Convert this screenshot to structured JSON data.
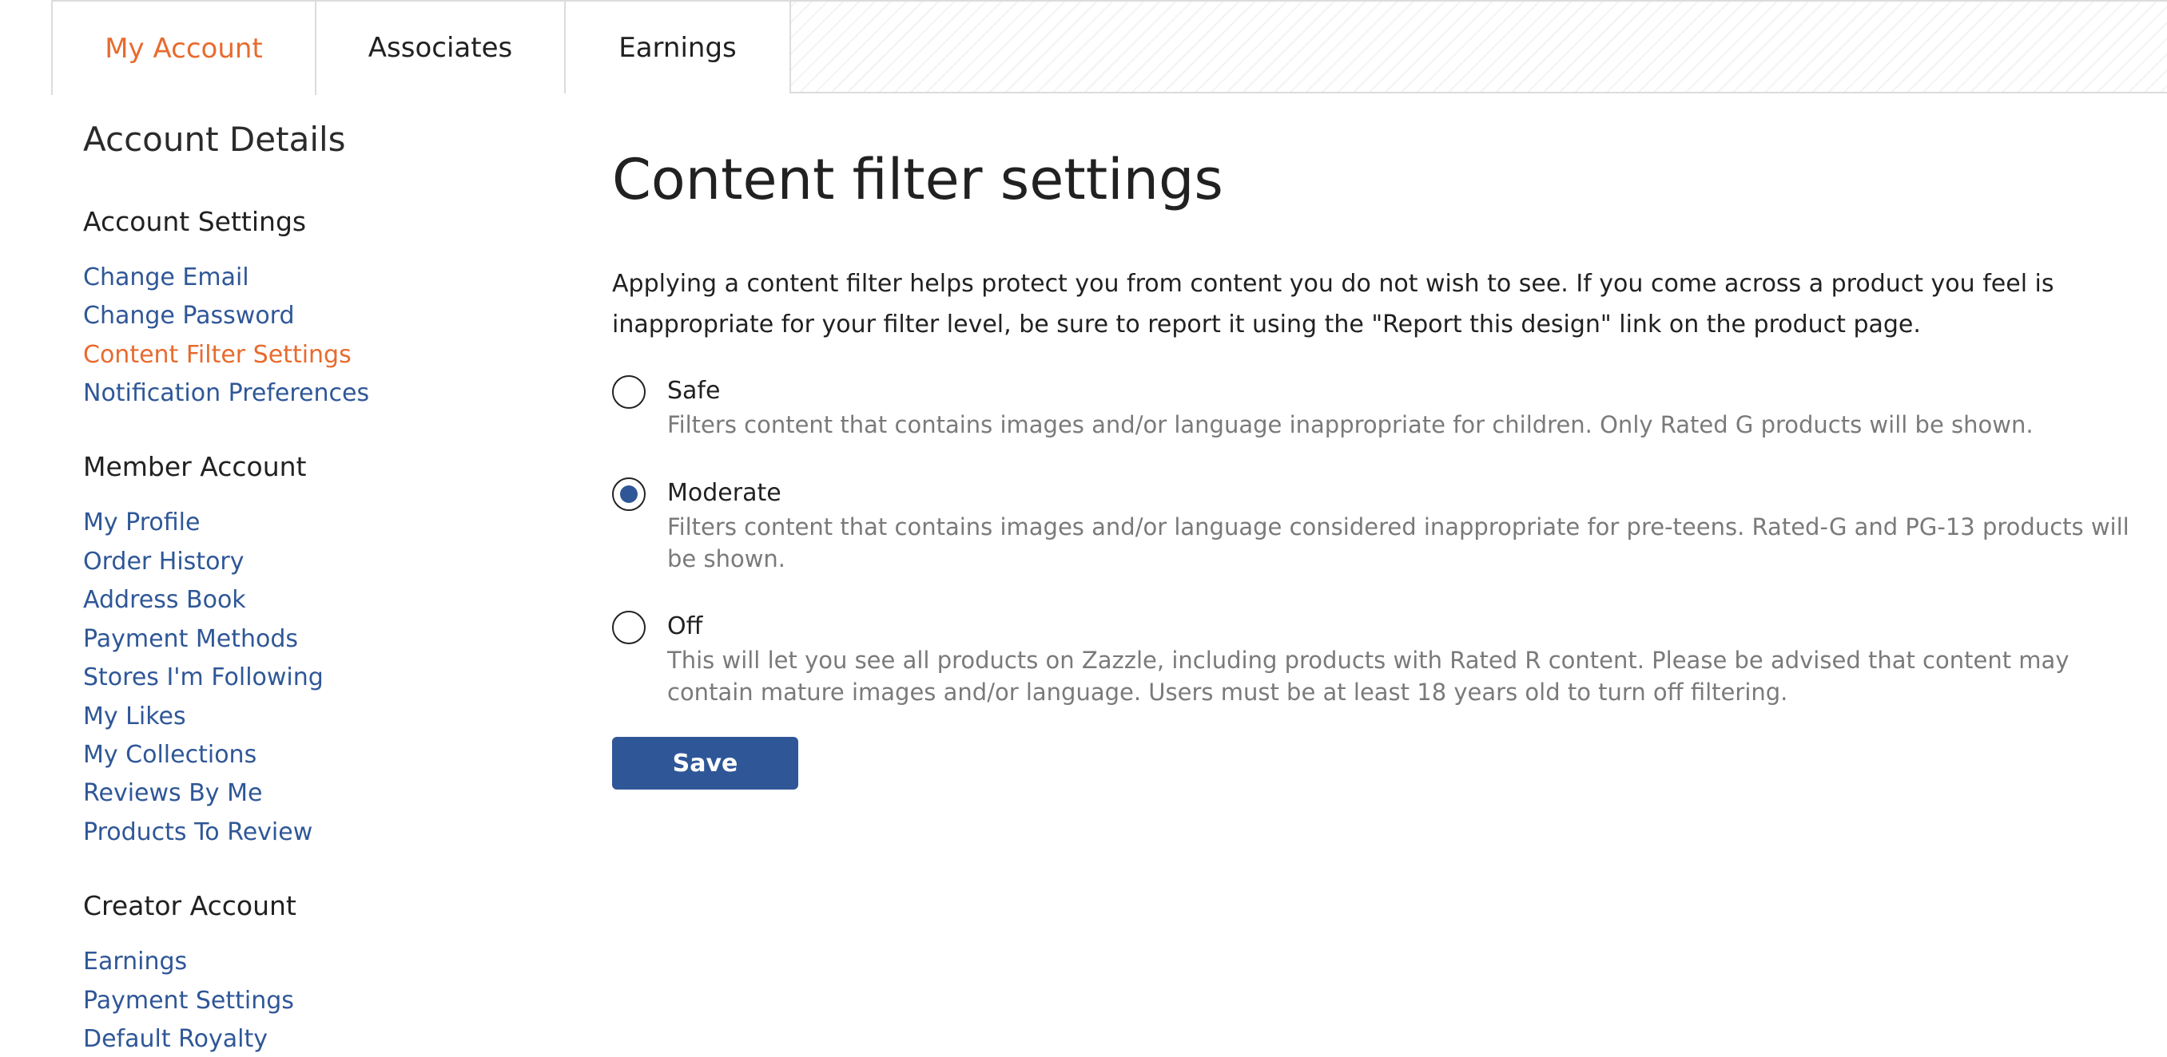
{
  "tabs": [
    {
      "label": "My Account",
      "active": true
    },
    {
      "label": "Associates",
      "active": false
    },
    {
      "label": "Earnings",
      "active": false
    }
  ],
  "sidebar": {
    "title": "Account Details",
    "sections": [
      {
        "heading": "Account Settings",
        "links": [
          "Change Email",
          "Change Password",
          "Content Filter Settings",
          "Notification Preferences"
        ]
      },
      {
        "heading": "Member Account",
        "links": [
          "My Profile",
          "Order History",
          "Address Book",
          "Payment Methods",
          "Stores I'm Following",
          "My Likes",
          "My Collections",
          "Reviews By Me",
          "Products To Review"
        ]
      },
      {
        "heading": "Creator Account",
        "links": [
          "Earnings",
          "Payment Settings",
          "Default Royalty"
        ]
      }
    ],
    "active_link": "Content Filter Settings"
  },
  "main": {
    "title": "Content filter settings",
    "intro": "Applying a content filter helps protect you from content you do not wish to see. If you come across a product you feel is inappropriate for your filter level, be sure to report it using the \"Report this design\" link on the product page.",
    "options": [
      {
        "label": "Safe",
        "description": "Filters content that contains images and/or language inappropriate for children. Only Rated G products will be shown.",
        "checked": false
      },
      {
        "label": "Moderate",
        "description": "Filters content that contains images and/or language considered inappropriate for pre-teens. Rated-G and PG-13 products will be shown.",
        "checked": true
      },
      {
        "label": "Off",
        "description": "This will let you see all products on Zazzle, including products with Rated R content. Please be advised that content may contain mature images and/or language. Users must be at least 18 years old to turn off filtering.",
        "checked": false
      }
    ],
    "save_label": "Save"
  },
  "colors": {
    "accent_orange": "#e76b2e",
    "link_blue": "#2f5797",
    "button_blue": "#2f5797",
    "muted_text": "#7a7a7a"
  }
}
